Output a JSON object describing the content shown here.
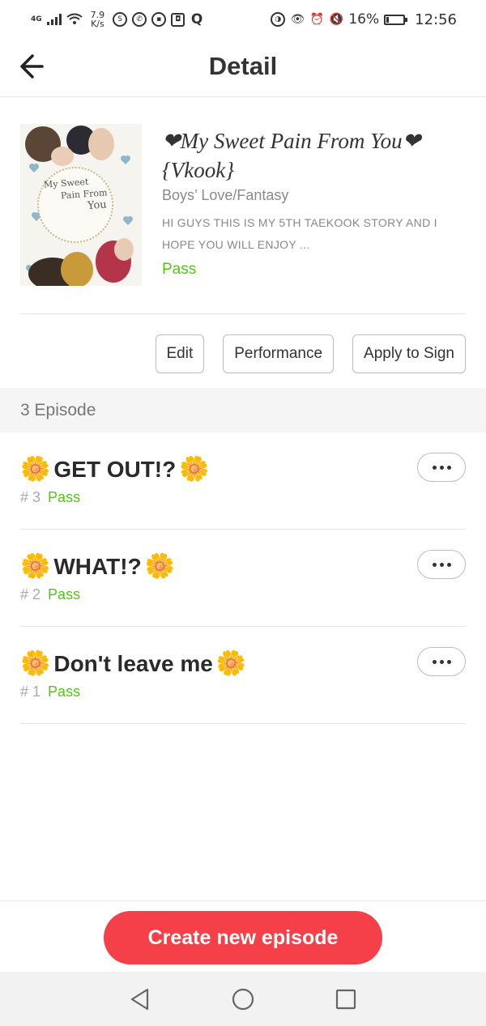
{
  "status_bar": {
    "network": "4G",
    "speed_value": "7.9",
    "speed_unit": "K/s",
    "battery_percent": "16%",
    "battery_level": 0.16,
    "time": "12:56"
  },
  "header": {
    "title": "Detail",
    "back_icon": "arrow-left-icon"
  },
  "book": {
    "title": "❤My Sweet Pain From You❤{Vkook}",
    "genre": "Boys’ Love/Fantasy",
    "description": "Hi guys this is my 5th taekook story and I hope you will enjoy ...",
    "status": "Pass",
    "cover_text": [
      "My Sweet",
      "Pain From",
      "You"
    ]
  },
  "actions": {
    "edit": "Edit",
    "performance": "Performance",
    "apply_to_sign": "Apply to Sign"
  },
  "episodes_header": "3 Episode",
  "episodes": [
    {
      "title": "GET OUT!?",
      "number": "# 3",
      "status": "Pass"
    },
    {
      "title": "WHAT!?",
      "number": "# 2",
      "status": "Pass"
    },
    {
      "title": "Don't leave me",
      "number": "# 1",
      "status": "Pass"
    }
  ],
  "create_button": "Create new episode",
  "colors": {
    "accent_red": "#f5404a",
    "pass_green": "#52c41a"
  }
}
